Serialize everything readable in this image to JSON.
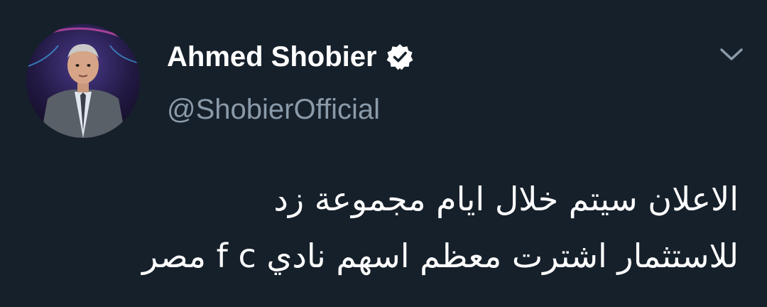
{
  "tweet": {
    "author": {
      "display_name": "Ahmed Shobier",
      "handle": "@ShobierOfficial",
      "verified_icon": "verified-badge-icon",
      "avatar_icon": "profile-photo"
    },
    "menu_icon": "chevron-down-icon",
    "text_lines": [
      "الاعلان سيتم خلال ايام مجموعة زد",
      "للاستثمار اشترت معظم اسهم نادي f c مصر"
    ],
    "colors": {
      "background": "#16202b",
      "name": "#ffffff",
      "handle": "#8a9aa9",
      "text": "#ffffff",
      "chevron": "#8a9aa9"
    }
  }
}
